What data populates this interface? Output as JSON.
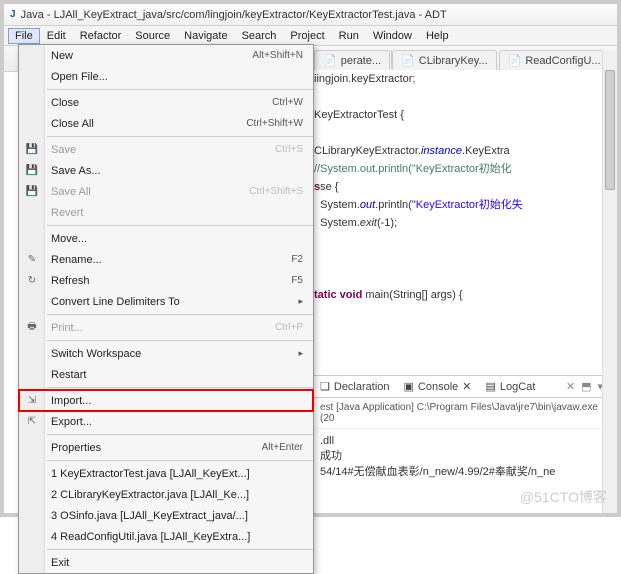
{
  "title": "Java - LJAll_KeyExtract_java/src/com/lingjoin/keyExtractor/KeyExtractorTest.java - ADT",
  "menubar": [
    "File",
    "Edit",
    "Refactor",
    "Source",
    "Navigate",
    "Search",
    "Project",
    "Run",
    "Window",
    "Help"
  ],
  "file_menu": {
    "groups": [
      [
        {
          "label": "New",
          "shortcut": "Alt+Shift+N",
          "sub": true,
          "icon": ""
        },
        {
          "label": "Open File...",
          "icon": ""
        }
      ],
      [
        {
          "label": "Close",
          "shortcut": "Ctrl+W"
        },
        {
          "label": "Close All",
          "shortcut": "Ctrl+Shift+W"
        }
      ],
      [
        {
          "label": "Save",
          "shortcut": "Ctrl+S",
          "disabled": true,
          "icon": "💾"
        },
        {
          "label": "Save As...",
          "icon": "💾"
        },
        {
          "label": "Save All",
          "shortcut": "Ctrl+Shift+S",
          "disabled": true,
          "icon": "💾"
        },
        {
          "label": "Revert",
          "disabled": true
        }
      ],
      [
        {
          "label": "Move..."
        },
        {
          "label": "Rename...",
          "shortcut": "F2",
          "icon": "✎"
        },
        {
          "label": "Refresh",
          "shortcut": "F5",
          "icon": "↻"
        },
        {
          "label": "Convert Line Delimiters To",
          "sub": true
        }
      ],
      [
        {
          "label": "Print...",
          "shortcut": "Ctrl+P",
          "disabled": true,
          "icon": "🖶"
        }
      ],
      [
        {
          "label": "Switch Workspace",
          "sub": true
        },
        {
          "label": "Restart"
        }
      ],
      [
        {
          "label": "Import...",
          "icon": "⇲",
          "hot": true
        },
        {
          "label": "Export...",
          "icon": "⇱"
        }
      ],
      [
        {
          "label": "Properties",
          "shortcut": "Alt+Enter"
        }
      ],
      [
        {
          "label": "1 KeyExtractorTest.java  [LJAll_KeyExt...]"
        },
        {
          "label": "2 CLibraryKeyExtractor.java  [LJAll_Ke...]"
        },
        {
          "label": "3 OSinfo.java  [LJAll_KeyExtract_java/...]"
        },
        {
          "label": "4 ReadConfigUtil.java  [LJAll_KeyExtra...]"
        }
      ],
      [
        {
          "label": "Exit"
        }
      ]
    ]
  },
  "tabs": [
    {
      "label": "perate..."
    },
    {
      "label": "CLibraryKey..."
    },
    {
      "label": "ReadConfigU..."
    }
  ],
  "code": {
    "l1": "iingjoin.keyExtractor;",
    "l2a": " KeyExtractorTest {",
    "l3a": " CLibraryKeyExtractor.",
    "l3b": "instance",
    "l3c": ".KeyExtra",
    "l4a": "//System.out.println(\"KeyExtractor初始化",
    "l5": "se {",
    "l6a": "System.",
    "l6b": "out",
    "l6c": ".println(",
    "l6d": "\"KeyExtractor初始化失",
    "l6e": "",
    "l7a": "System.",
    "l7b": "exit",
    "l7c": "(-1);",
    "l8a": "tatic void ",
    "l8b": "main",
    "l8c": "(String[] args) {"
  },
  "console": {
    "tabs": [
      "Declaration",
      "Console",
      "LogCat"
    ],
    "info": "est [Java Application] C:\\Program Files\\Java\\jre7\\bin\\javaw.exe (20",
    "out1": ".dll",
    "out2": "成功",
    "out3": "54/14#无偿献血表彰/n_new/4.99/2#奉献奖/n_ne"
  },
  "watermark": "@51CTO博客"
}
